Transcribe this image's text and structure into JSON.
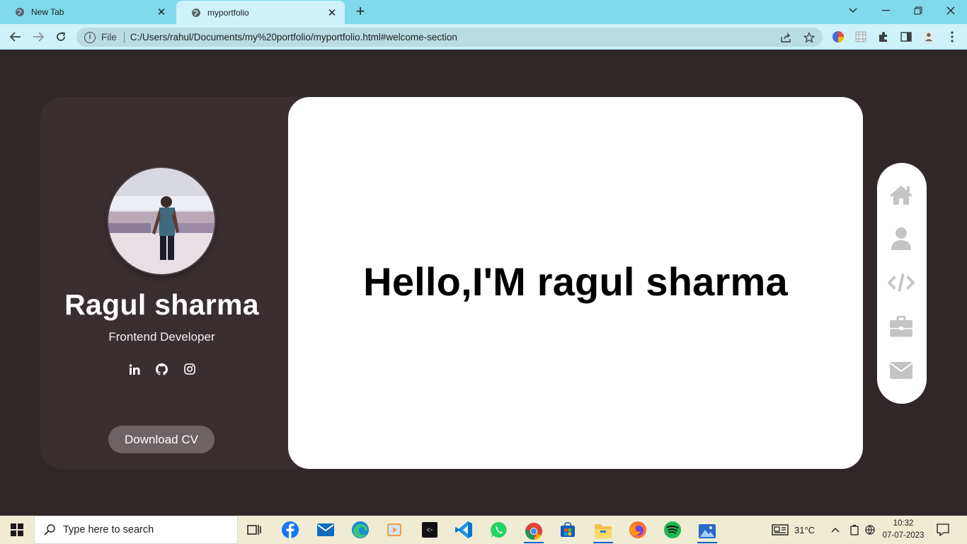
{
  "browser": {
    "tabs": [
      {
        "title": "New Tab",
        "active": false
      },
      {
        "title": "myportfolio",
        "active": true
      }
    ],
    "address": {
      "scheme_label": "File",
      "url": "C:/Users/rahul/Documents/my%20portfolio/myportfolio.html#welcome-section"
    },
    "colors": {
      "tabstrip": "#7fd9eb",
      "toolbar": "#cdf2fa",
      "omnibox": "#b9dbe4"
    }
  },
  "profile": {
    "name": "Ragul sharma",
    "role": "Frontend Developer",
    "socials": [
      {
        "icon": "linkedin-icon",
        "label": "in"
      },
      {
        "icon": "github-icon"
      },
      {
        "icon": "instagram-icon"
      }
    ],
    "cv_button": "Download CV"
  },
  "hero": {
    "title": "Hello,I'M ragul sharma"
  },
  "side_nav": {
    "items": [
      {
        "icon": "home-icon"
      },
      {
        "icon": "user-icon"
      },
      {
        "icon": "code-icon"
      },
      {
        "icon": "briefcase-icon"
      },
      {
        "icon": "envelope-icon"
      }
    ],
    "icon_color": "#c4c4c4"
  },
  "page_colors": {
    "background": "#302828",
    "card": "#392f30",
    "hero": "#ffffff",
    "button": "#6d6364"
  },
  "taskbar": {
    "search_placeholder": "Type here to search",
    "apps": [
      "task-view-icon",
      "facebook-icon",
      "mail-icon",
      "edge-icon",
      "media-player-icon",
      "terminal-icon",
      "vscode-icon",
      "whatsapp-icon",
      "chrome-icon",
      "store-icon",
      "file-explorer-icon",
      "firefox-icon",
      "spotify-icon",
      "photos-icon"
    ],
    "weather": "31°C",
    "time": "10:32",
    "date": "07-07-2023"
  }
}
